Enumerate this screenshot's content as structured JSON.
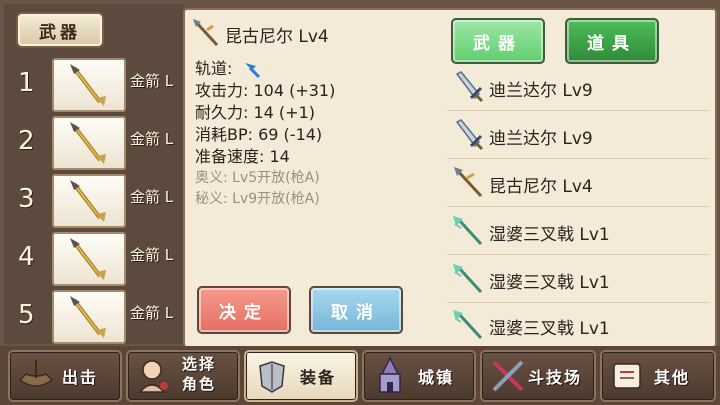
{
  "left": {
    "tab_label": "武器",
    "slots": [
      {
        "num": "1",
        "name": "金箭 L"
      },
      {
        "num": "2",
        "name": "金箭 L"
      },
      {
        "num": "3",
        "name": "金箭 L"
      },
      {
        "num": "4",
        "name": "金箭 L"
      },
      {
        "num": "5",
        "name": "金箭 L"
      }
    ]
  },
  "detail": {
    "title": "昆古尼尔 Lv4",
    "track_label": "轨道:",
    "attack": "攻击力: 104 (+31)",
    "durability": "耐久力: 14 (+1)",
    "bp_cost": "消耗BP: 69 (-14)",
    "prep_speed": "准备速度: 14",
    "secret1": "奥义:  Lv5开放(枪A)",
    "secret2": "秘义:  Lv9开放(枪A)",
    "confirm": "决定",
    "cancel": "取消"
  },
  "tabs": {
    "weapon": "武器",
    "item": "道具"
  },
  "inventory": [
    {
      "name": "迪兰达尔 Lv9",
      "icon": "sword-icon"
    },
    {
      "name": "迪兰达尔 Lv9",
      "icon": "sword-icon"
    },
    {
      "name": "昆古尼尔 Lv4",
      "icon": "spear-icon"
    },
    {
      "name": "湿婆三叉戟 Lv1",
      "icon": "trident-icon"
    },
    {
      "name": "湿婆三叉戟 Lv1",
      "icon": "trident-icon"
    },
    {
      "name": "湿婆三叉戟 Lv1",
      "icon": "trident-icon"
    }
  ],
  "nav": [
    {
      "label": "出击",
      "icon": "ship-icon"
    },
    {
      "label": "选择",
      "label2": "角色",
      "icon": "character-icon"
    },
    {
      "label": "装备",
      "icon": "armor-icon"
    },
    {
      "label": "城镇",
      "icon": "castle-icon"
    },
    {
      "label": "斗技场",
      "icon": "swords-icon"
    },
    {
      "label": "其他",
      "icon": "scroll-icon"
    }
  ],
  "colors": {
    "accent_green": "#5fcf6e",
    "confirm_red": "#e46f64",
    "cancel_blue": "#74b7d8",
    "panel_bg": "#f3ead7"
  }
}
